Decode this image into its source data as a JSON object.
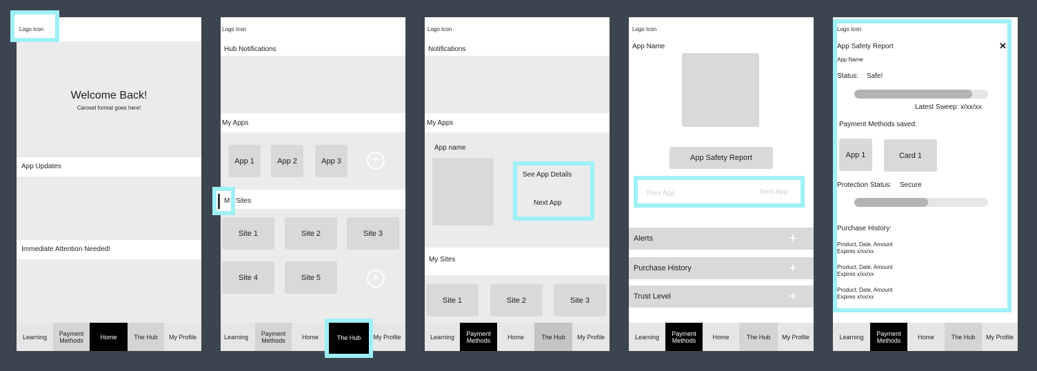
{
  "nav": {
    "learning": "Learning",
    "payment_methods": "Payment Methods",
    "home": "Home",
    "the_hub": "The Hub",
    "my_profile": "My Profile"
  },
  "logo": "Logo Icon",
  "screen1": {
    "welcome_title": "Welcome Back!",
    "welcome_subtitle": "Carosel format goes here!",
    "app_updates": "App Updates",
    "attention": "Immediate Attention Needed!"
  },
  "screen2": {
    "hub_notifications": "Hub Notifications",
    "my_apps": "My Apps",
    "apps": [
      "App 1",
      "App 2",
      "App 3"
    ],
    "my_sites_prefix": "M",
    "my_sites_suffix": "Sites",
    "sites": [
      "Site 1",
      "Site 2",
      "Site 3",
      "Site 4",
      "Site 5"
    ]
  },
  "screen3": {
    "notifications": "Notifications",
    "my_apps": "My Apps",
    "app_name": "App name",
    "see_details": "See App Details",
    "next_app": "Next App",
    "my_sites": "My Sites",
    "sites": [
      "Site 1",
      "Site 2",
      "Site 3"
    ]
  },
  "screen4": {
    "app_name": "App Name",
    "safety_report": "App Safety Report",
    "prev_app": "Prev App",
    "next_app": "Next App",
    "alerts": "Alerts",
    "purchase_history": "Purchase History",
    "trust_level": "Trust Level"
  },
  "screen5": {
    "title": "App Safety Report",
    "close": "✕",
    "app_name": "App Name",
    "status_label": "Status:",
    "status_value": "Safe!",
    "status_progress": 0.88,
    "latest_sweep": "Latest Sweep: x/xx/xx",
    "payment_methods": "Payment Methods saved:",
    "app1": "App 1",
    "card1": "Card 1",
    "protection_label": "Protection Status:",
    "protection_value": "Secure",
    "protection_progress": 0.55,
    "purchase_history": "Purchase History:",
    "purchases": [
      {
        "line1": "Product, Date, Amount",
        "line2": "Expires x/xx/xx"
      },
      {
        "line1": "Product, Date, Amount",
        "line2": "Expires x/xx/xx"
      },
      {
        "line1": "Product, Date, Amount",
        "line2": "Expires x/xx/xx"
      }
    ]
  }
}
